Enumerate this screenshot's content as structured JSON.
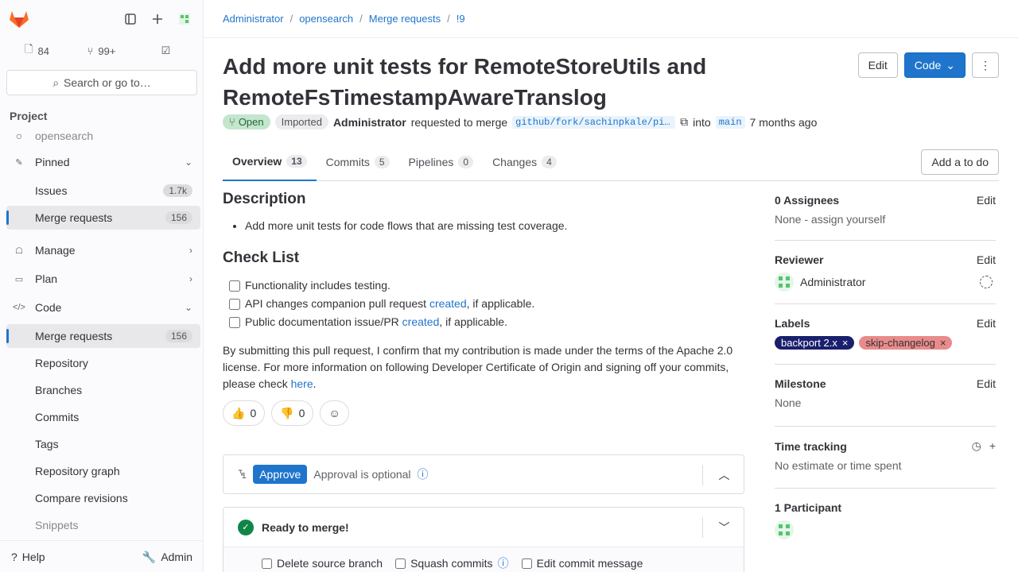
{
  "sidebar": {
    "counts": [
      {
        "icon": "issues-icon",
        "value": "84"
      },
      {
        "icon": "merge-request-icon",
        "value": "99+"
      },
      {
        "icon": "todo-icon",
        "value": ""
      }
    ],
    "search_label": "Search or go to…",
    "section_title": "Project",
    "project_name": "opensearch",
    "items": [
      {
        "label": "Pinned",
        "icon": "pin-icon",
        "chevron": "down"
      },
      {
        "label": "Issues",
        "badge": "1.7k"
      },
      {
        "label": "Merge requests",
        "badge": "156",
        "active": true
      },
      {
        "label": "Manage",
        "icon": "manage-icon",
        "chevron": "right"
      },
      {
        "label": "Plan",
        "icon": "plan-icon",
        "chevron": "right"
      },
      {
        "label": "Code",
        "icon": "code-icon",
        "chevron": "down"
      },
      {
        "label": "Merge requests",
        "badge": "156",
        "active": true
      },
      {
        "label": "Repository"
      },
      {
        "label": "Branches"
      },
      {
        "label": "Commits"
      },
      {
        "label": "Tags"
      },
      {
        "label": "Repository graph"
      },
      {
        "label": "Compare revisions"
      },
      {
        "label": "Snippets"
      }
    ],
    "help_label": "Help",
    "admin_label": "Admin"
  },
  "breadcrumb": [
    "Administrator",
    "opensearch",
    "Merge requests",
    "!9"
  ],
  "mr": {
    "title": "Add more unit tests for RemoteStoreUtils and RemoteFsTimestampAwareTranslog",
    "edit_label": "Edit",
    "code_label": "Code",
    "status": "Open",
    "imported": "Imported",
    "author": "Administrator",
    "requested_text": "requested to merge",
    "source_branch": "github/fork/sachinpkale/pin…",
    "into_text": "into",
    "target_branch": "main",
    "time": "7 months ago"
  },
  "tabs": [
    {
      "label": "Overview",
      "count": "13",
      "active": true
    },
    {
      "label": "Commits",
      "count": "5"
    },
    {
      "label": "Pipelines",
      "count": "0"
    },
    {
      "label": "Changes",
      "count": "4"
    }
  ],
  "todo_label": "Add a to do",
  "description": {
    "heading": "Description",
    "bullet": "Add more unit tests for code flows that are missing test coverage.",
    "checklist_heading": "Check List",
    "checks": [
      {
        "text": "Functionality includes testing.",
        "link": ""
      },
      {
        "text": "API changes companion pull request",
        "link": "created",
        "suffix": ", if applicable."
      },
      {
        "text": "Public documentation issue/PR",
        "link": "created",
        "suffix": ", if applicable."
      }
    ],
    "para": "By submitting this pull request, I confirm that my contribution is made under the terms of the Apache 2.0 license. For more information on following Developer Certificate of Origin and signing off your commits, please check",
    "para_link": "here"
  },
  "reactions": {
    "thumbsup": "0",
    "thumbsdown": "0"
  },
  "approval": {
    "button": "Approve",
    "text": "Approval is optional"
  },
  "merge": {
    "title": "Ready to merge!",
    "options": [
      "Delete source branch",
      "Squash commits",
      "Edit commit message"
    ]
  },
  "right": {
    "assignees": {
      "label": "0 Assignees",
      "edit": "Edit",
      "value": "None - assign yourself"
    },
    "reviewer": {
      "label": "Reviewer",
      "edit": "Edit",
      "name": "Administrator"
    },
    "labels": {
      "label": "Labels",
      "edit": "Edit",
      "items": [
        {
          "text": "backport 2.x",
          "color": "#1a1f6e"
        },
        {
          "text": "skip-changelog",
          "color": "#e98b8b"
        }
      ]
    },
    "milestone": {
      "label": "Milestone",
      "edit": "Edit",
      "value": "None"
    },
    "time": {
      "label": "Time tracking",
      "value": "No estimate or time spent"
    },
    "participants": {
      "label": "1 Participant"
    }
  }
}
